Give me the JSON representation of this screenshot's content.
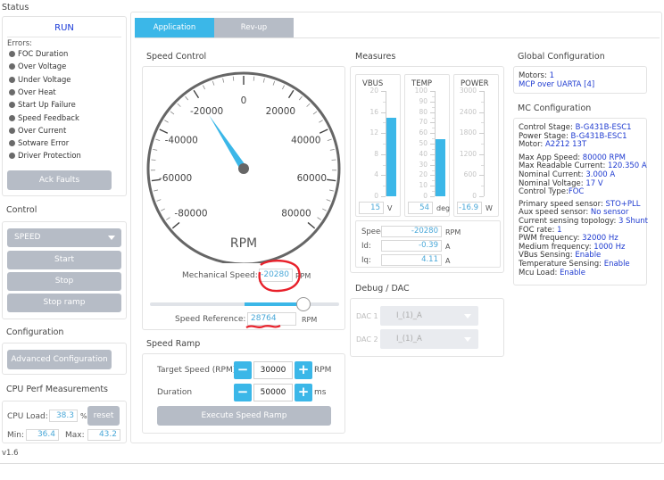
{
  "status": {
    "title": "Status",
    "state": "RUN",
    "errors_label": "Errors:",
    "errors": [
      "FOC Duration",
      "Over Voltage",
      "Under Voltage",
      "Over Heat",
      "Start Up Failure",
      "Speed Feedback",
      "Over Current",
      "Sotware Error",
      "Driver Protection"
    ],
    "ack_button": "Ack Faults"
  },
  "control": {
    "title": "Control",
    "mode": "SPEED",
    "buttons": [
      "Start",
      "Stop",
      "Stop ramp"
    ]
  },
  "configuration": {
    "title": "Configuration",
    "button": "Advanced Configuration"
  },
  "cpu": {
    "title": "CPU Perf Measurements",
    "load_label": "CPU Load:",
    "load_value": "38.3",
    "load_unit": "%",
    "reset_button": "reset",
    "min_label": "Min:",
    "min_value": "36.4",
    "max_label": "Max:",
    "max_value": "43.2"
  },
  "version": "v1.6",
  "tabs": [
    "Application",
    "Rev-up"
  ],
  "speed_control": {
    "title": "Speed Control",
    "gauge": {
      "labels": [
        "-80000",
        "-60000",
        "-40000",
        "-20000",
        "0",
        "20000",
        "40000",
        "60000",
        "80000"
      ],
      "unit": "RPM",
      "value": -20280,
      "min": -80000,
      "max": 80000
    },
    "mech_label": "Mechanical Speed:",
    "mech_value": "-20280",
    "mech_unit": "RPM",
    "slider_fraction": 0.81,
    "ref_label": "Speed Reference:",
    "ref_value": "28764",
    "ref_unit": "RPM"
  },
  "speed_ramp": {
    "title": "Speed Ramp",
    "target_label": "Target Speed (RPM)",
    "target_value": "30000",
    "target_unit": "RPM",
    "duration_label": "Duration",
    "duration_value": "50000",
    "duration_unit": "ms",
    "execute_button": "Execute Speed Ramp",
    "minus": "−",
    "plus": "+"
  },
  "measures": {
    "title": "Measures",
    "meters": [
      {
        "name": "VBUS",
        "ticks": [
          "20",
          "16",
          "12",
          "8",
          "4",
          "0"
        ],
        "value": "15",
        "unit": "V",
        "fill": 0.75
      },
      {
        "name": "TEMP",
        "ticks": [
          "100",
          "90",
          "80",
          "70",
          "60",
          "50",
          "40",
          "30",
          "20",
          "10",
          "0"
        ],
        "value": "54",
        "unit": "deg",
        "fill": 0.54
      },
      {
        "name": "POWER",
        "ticks": [
          "3000",
          "2400",
          "1800",
          "1200",
          "600",
          "0"
        ],
        "value": "-16.9",
        "unit": "W",
        "fill": 0.0
      }
    ],
    "readings": [
      {
        "label": "Speed:",
        "value": "-20280",
        "unit": "RPM"
      },
      {
        "label": "Id:",
        "value": "-0.39",
        "unit": "A"
      },
      {
        "label": "Iq:",
        "value": "4.11",
        "unit": "A"
      }
    ]
  },
  "debug": {
    "title": "Debug / DAC",
    "dacs": [
      {
        "label": "DAC 1",
        "value": "I_(1)_A"
      },
      {
        "label": "DAC 2",
        "value": "I_(1)_A"
      }
    ]
  },
  "global_config": {
    "title": "Global Configuration",
    "lines": [
      {
        "k": "Motors: ",
        "v": "1"
      },
      {
        "k": "",
        "v": "MCP over UARTA [4]"
      }
    ]
  },
  "mc_config": {
    "title": "MC Configuration",
    "lines": [
      {
        "k": "Control Stage: ",
        "v": "B-G431B-ESC1"
      },
      {
        "k": "Power Stage: ",
        "v": "B-G431B-ESC1"
      },
      {
        "k": "Motor: ",
        "v": "A2212 13T"
      },
      {
        "k": "Max App Speed: ",
        "v": "80000 RPM"
      },
      {
        "k": "Max Readable Current: ",
        "v": "120.350 A"
      },
      {
        "k": "Nominal Current: ",
        "v": "3.000 A"
      },
      {
        "k": "Nominal Voltage: ",
        "v": "17 V"
      },
      {
        "k": "Control Type:",
        "v": "FOC"
      },
      {
        "k": "Primary speed sensor: ",
        "v": "STO+PLL"
      },
      {
        "k": "Aux speed sensor: ",
        "v": "No sensor"
      },
      {
        "k": "Current sensing topology: ",
        "v": "3 Shunt"
      },
      {
        "k": "FOC rate: ",
        "v": "1"
      },
      {
        "k": "PWM frequency: ",
        "v": "32000 Hz"
      },
      {
        "k": "Medium frequency: ",
        "v": "1000 Hz"
      },
      {
        "k": "VBus Sensing: ",
        "v": "Enable"
      },
      {
        "k": "Temperature Sensing: ",
        "v": "Enable"
      },
      {
        "k": "Mcu Load: ",
        "v": "Enable"
      }
    ]
  },
  "colors": {
    "accent": "#3bb7e8",
    "tab_inactive": "#b6bcc6",
    "button_gray": "#b6bcc6",
    "annotation_red": "#e8202a"
  }
}
